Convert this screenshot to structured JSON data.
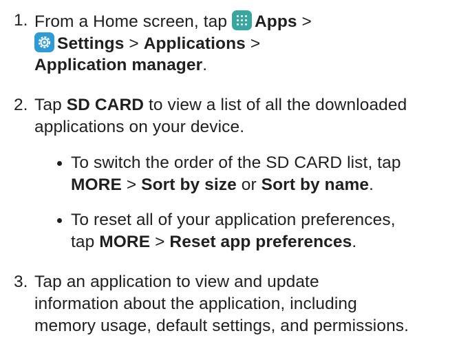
{
  "steps": [
    {
      "number": "1.",
      "lines": [
        {
          "pre": "From a Home screen, tap ",
          "icon": "apps-icon",
          "bold": "Apps",
          "post": " >"
        },
        {
          "icon": "settings-icon",
          "bold": "Settings",
          "mid": " > ",
          "bold2": "Applications",
          "post": " >"
        },
        {
          "bold": "Application manager",
          "post": "."
        }
      ]
    },
    {
      "number": "2.",
      "lines": [
        {
          "pre": "Tap ",
          "bold": "SD CARD",
          "post": " to view a list of all the downloaded"
        },
        {
          "pre": "applications on your device."
        }
      ],
      "bullets": [
        {
          "lines": [
            {
              "pre": "To switch the order of the SD CARD list, tap"
            },
            {
              "bold": "MORE",
              "mid": " > ",
              "bold2": "Sort by size",
              "mid2": " or ",
              "bold3": "Sort by name",
              "post": "."
            }
          ]
        },
        {
          "lines": [
            {
              "pre": "To reset all of your application preferences,"
            },
            {
              "pre": "tap ",
              "bold": "MORE",
              "mid": " > ",
              "bold2": "Reset app preferences",
              "post": "."
            }
          ]
        }
      ]
    },
    {
      "number": "3.",
      "lines": [
        {
          "pre": "Tap an application to view and update"
        },
        {
          "pre": "information about the application, including"
        },
        {
          "pre": "memory usage, default settings, and permissions."
        }
      ]
    }
  ]
}
